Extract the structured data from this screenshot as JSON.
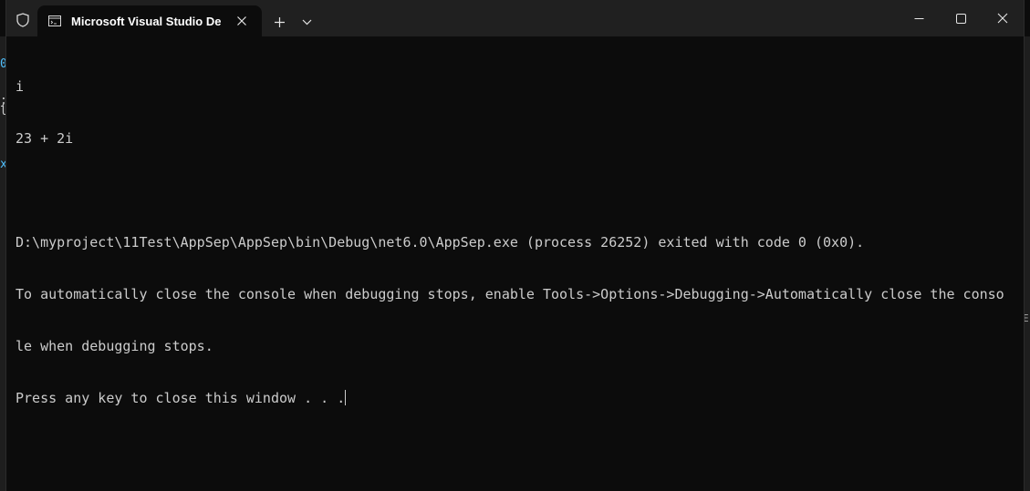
{
  "window": {
    "tab_title": "Microsoft Visual Studio Debug Console",
    "new_tab_icon": "plus-icon",
    "tab_menu_icon": "chevron-down-icon",
    "controls": [
      "minimize-icon",
      "maximize-icon",
      "close-icon"
    ]
  },
  "background_editor": {
    "left_glyphs": [
      "0",
      ";",
      "l",
      "x"
    ],
    "right_glyphs": [
      "E"
    ]
  },
  "terminal": {
    "lines": [
      "i",
      "23 + 2i",
      "",
      "D:\\myproject\\11Test\\AppSep\\AppSep\\bin\\Debug\\net6.0\\AppSep.exe (process 26252) exited with code 0 (0x0).",
      "To automatically close the console when debugging stops, enable Tools->Options->Debugging->Automatically close the conso",
      "le when debugging stops.",
      "Press any key to close this window . . ."
    ]
  },
  "colors": {
    "terminal_bg": "#0c0c0c",
    "titlebar_bg": "#202020",
    "text": "#cccccc"
  }
}
